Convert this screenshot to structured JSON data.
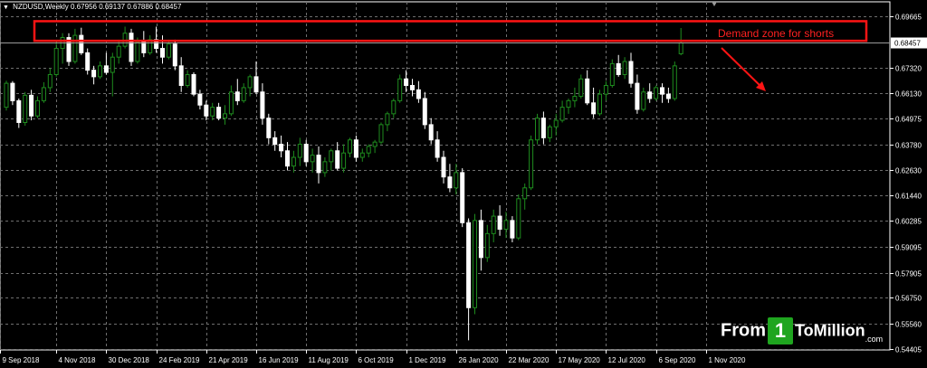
{
  "window": {
    "symbol": "NZDUSD,Weekly",
    "ohlc": "0.67956 0.69137 0.67886 0.68457"
  },
  "annotation": {
    "text": "Demand zone for shorts"
  },
  "watermark": {
    "part1": "From",
    "part2": "1",
    "part3": "ToMillion",
    "part4": ".com"
  },
  "colors": {
    "background": "#000000",
    "grid": "#6e6e6e",
    "axis_text": "#ffffff",
    "bull_candle": "#1e8c1e",
    "bear_candle": "#ffffff",
    "bull_wick": "#1e8c1e",
    "bear_wick": "#ffffff",
    "annotation": "#ff1414",
    "price_tag_bg": "#ffffff",
    "price_tag_text": "#000000",
    "watermark_green": "#1fa51f"
  },
  "chart_data": {
    "type": "candlestick",
    "symbol": "NZDUSD",
    "timeframe": "Weekly",
    "current_price": 0.68457,
    "ylim": [
      0.5436,
      0.7034
    ],
    "y_ticks": [
      0.69665,
      0.68457,
      0.6732,
      0.6613,
      0.6497,
      0.6378,
      0.6263,
      0.6144,
      0.6028,
      0.5909,
      0.579,
      0.5675,
      0.5556,
      0.544
    ],
    "y_tick_labels": [
      "0.69665",
      "0.68457",
      "0.67320",
      "0.66130",
      "0.64975",
      "0.63780",
      "0.62630",
      "0.61440",
      "0.60285",
      "0.59095",
      "0.57905",
      "0.56750",
      "0.55560",
      "0.54405"
    ],
    "x_tick_labels": [
      {
        "label": "9 Sep 2018",
        "bar": 0
      },
      {
        "label": "4 Nov 2018",
        "bar": 8
      },
      {
        "label": "30 Dec 2018",
        "bar": 16
      },
      {
        "label": "24 Feb 2019",
        "bar": 24
      },
      {
        "label": "21 Apr 2019",
        "bar": 32
      },
      {
        "label": "16 Jun 2019",
        "bar": 40
      },
      {
        "label": "11 Aug 2019",
        "bar": 48
      },
      {
        "label": "6 Oct 2019",
        "bar": 56
      },
      {
        "label": "1 Dec 2019",
        "bar": 64
      },
      {
        "label": "26 Jan 2020",
        "bar": 72
      },
      {
        "label": "22 Mar 2020",
        "bar": 80
      },
      {
        "label": "17 May 2020",
        "bar": 88
      },
      {
        "label": "12 Jul 2020",
        "bar": 96
      },
      {
        "label": "6 Sep 2020",
        "bar": 104
      },
      {
        "label": "1 Nov 2020",
        "bar": 112
      }
    ],
    "candles": [
      [
        0.655,
        0.6672,
        0.6535,
        0.666
      ],
      [
        0.666,
        0.667,
        0.656,
        0.658
      ],
      [
        0.658,
        0.659,
        0.6455,
        0.648
      ],
      [
        0.648,
        0.662,
        0.6465,
        0.6605
      ],
      [
        0.6605,
        0.663,
        0.649,
        0.651
      ],
      [
        0.651,
        0.66,
        0.65,
        0.658
      ],
      [
        0.658,
        0.6665,
        0.657,
        0.664
      ],
      [
        0.664,
        0.673,
        0.662,
        0.67
      ],
      [
        0.67,
        0.685,
        0.669,
        0.682
      ],
      [
        0.682,
        0.689,
        0.675,
        0.687
      ],
      [
        0.687,
        0.689,
        0.674,
        0.676
      ],
      [
        0.676,
        0.691,
        0.675,
        0.688
      ],
      [
        0.688,
        0.6915,
        0.679,
        0.68
      ],
      [
        0.68,
        0.682,
        0.67,
        0.672
      ],
      [
        0.672,
        0.674,
        0.6655,
        0.669
      ],
      [
        0.669,
        0.676,
        0.668,
        0.674
      ],
      [
        0.674,
        0.68,
        0.67,
        0.671
      ],
      [
        0.671,
        0.68,
        0.66,
        0.678
      ],
      [
        0.678,
        0.686,
        0.675,
        0.683
      ],
      [
        0.683,
        0.692,
        0.682,
        0.689
      ],
      [
        0.689,
        0.691,
        0.674,
        0.676
      ],
      [
        0.676,
        0.687,
        0.675,
        0.685
      ],
      [
        0.685,
        0.69,
        0.678,
        0.68
      ],
      [
        0.68,
        0.688,
        0.679,
        0.686
      ],
      [
        0.686,
        0.692,
        0.68,
        0.682
      ],
      [
        0.682,
        0.688,
        0.675,
        0.678
      ],
      [
        0.678,
        0.686,
        0.677,
        0.684
      ],
      [
        0.684,
        0.686,
        0.672,
        0.674
      ],
      [
        0.674,
        0.678,
        0.662,
        0.665
      ],
      [
        0.665,
        0.672,
        0.664,
        0.67
      ],
      [
        0.67,
        0.671,
        0.66,
        0.661
      ],
      [
        0.661,
        0.663,
        0.654,
        0.656
      ],
      [
        0.656,
        0.658,
        0.649,
        0.651
      ],
      [
        0.651,
        0.657,
        0.649,
        0.655
      ],
      [
        0.655,
        0.657,
        0.649,
        0.65
      ],
      [
        0.65,
        0.656,
        0.647,
        0.652
      ],
      [
        0.652,
        0.665,
        0.651,
        0.662
      ],
      [
        0.662,
        0.668,
        0.656,
        0.658
      ],
      [
        0.658,
        0.666,
        0.657,
        0.664
      ],
      [
        0.664,
        0.67,
        0.66,
        0.669
      ],
      [
        0.669,
        0.676,
        0.661,
        0.662
      ],
      [
        0.662,
        0.666,
        0.647,
        0.65
      ],
      [
        0.65,
        0.652,
        0.638,
        0.641
      ],
      [
        0.641,
        0.644,
        0.635,
        0.638
      ],
      [
        0.638,
        0.642,
        0.632,
        0.635
      ],
      [
        0.635,
        0.639,
        0.626,
        0.628
      ],
      [
        0.628,
        0.635,
        0.625,
        0.632
      ],
      [
        0.632,
        0.641,
        0.628,
        0.638
      ],
      [
        0.638,
        0.64,
        0.628,
        0.63
      ],
      [
        0.63,
        0.636,
        0.625,
        0.633
      ],
      [
        0.633,
        0.637,
        0.62,
        0.625
      ],
      [
        0.625,
        0.632,
        0.623,
        0.63
      ],
      [
        0.63,
        0.636,
        0.626,
        0.635
      ],
      [
        0.635,
        0.639,
        0.626,
        0.627
      ],
      [
        0.627,
        0.638,
        0.625,
        0.634
      ],
      [
        0.634,
        0.641,
        0.632,
        0.64
      ],
      [
        0.64,
        0.642,
        0.63,
        0.632
      ],
      [
        0.632,
        0.636,
        0.63,
        0.634
      ],
      [
        0.634,
        0.638,
        0.632,
        0.637
      ],
      [
        0.637,
        0.64,
        0.634,
        0.639
      ],
      [
        0.639,
        0.648,
        0.638,
        0.647
      ],
      [
        0.647,
        0.653,
        0.644,
        0.652
      ],
      [
        0.652,
        0.659,
        0.65,
        0.658
      ],
      [
        0.658,
        0.67,
        0.657,
        0.668
      ],
      [
        0.668,
        0.672,
        0.662,
        0.665
      ],
      [
        0.665,
        0.668,
        0.66,
        0.663
      ],
      [
        0.663,
        0.667,
        0.657,
        0.659
      ],
      [
        0.659,
        0.662,
        0.645,
        0.647
      ],
      [
        0.647,
        0.65,
        0.638,
        0.64
      ],
      [
        0.64,
        0.644,
        0.63,
        0.632
      ],
      [
        0.632,
        0.635,
        0.62,
        0.623
      ],
      [
        0.623,
        0.629,
        0.616,
        0.618
      ],
      [
        0.618,
        0.629,
        0.615,
        0.625
      ],
      [
        0.625,
        0.627,
        0.6,
        0.602
      ],
      [
        0.602,
        0.604,
        0.548,
        0.563
      ],
      [
        0.563,
        0.606,
        0.56,
        0.603
      ],
      [
        0.603,
        0.608,
        0.58,
        0.586
      ],
      [
        0.586,
        0.601,
        0.584,
        0.597
      ],
      [
        0.597,
        0.608,
        0.593,
        0.605
      ],
      [
        0.605,
        0.61,
        0.596,
        0.599
      ],
      [
        0.599,
        0.607,
        0.595,
        0.603
      ],
      [
        0.603,
        0.605,
        0.593,
        0.595
      ],
      [
        0.595,
        0.615,
        0.594,
        0.613
      ],
      [
        0.613,
        0.62,
        0.608,
        0.618
      ],
      [
        0.618,
        0.642,
        0.617,
        0.64
      ],
      [
        0.64,
        0.652,
        0.638,
        0.65
      ],
      [
        0.65,
        0.653,
        0.638,
        0.641
      ],
      [
        0.641,
        0.647,
        0.639,
        0.646
      ],
      [
        0.646,
        0.652,
        0.642,
        0.649
      ],
      [
        0.649,
        0.658,
        0.648,
        0.655
      ],
      [
        0.655,
        0.659,
        0.652,
        0.658
      ],
      [
        0.658,
        0.664,
        0.655,
        0.66
      ],
      [
        0.66,
        0.67,
        0.659,
        0.668
      ],
      [
        0.668,
        0.672,
        0.656,
        0.657
      ],
      [
        0.657,
        0.664,
        0.65,
        0.652
      ],
      [
        0.652,
        0.663,
        0.651,
        0.661
      ],
      [
        0.661,
        0.667,
        0.658,
        0.665
      ],
      [
        0.665,
        0.677,
        0.664,
        0.675
      ],
      [
        0.675,
        0.679,
        0.669,
        0.67
      ],
      [
        0.67,
        0.678,
        0.668,
        0.676
      ],
      [
        0.676,
        0.68,
        0.664,
        0.666
      ],
      [
        0.666,
        0.67,
        0.652,
        0.654
      ],
      [
        0.654,
        0.664,
        0.653,
        0.662
      ],
      [
        0.662,
        0.666,
        0.657,
        0.659
      ],
      [
        0.659,
        0.665,
        0.658,
        0.664
      ],
      [
        0.664,
        0.666,
        0.657,
        0.661
      ],
      [
        0.661,
        0.664,
        0.657,
        0.659
      ],
      [
        0.659,
        0.676,
        0.658,
        0.674
      ],
      [
        0.67956,
        0.69137,
        0.67886,
        0.68457
      ]
    ],
    "demand_zone": {
      "low": 0.6855,
      "high": 0.6945,
      "label": "Demand zone for shorts"
    }
  }
}
